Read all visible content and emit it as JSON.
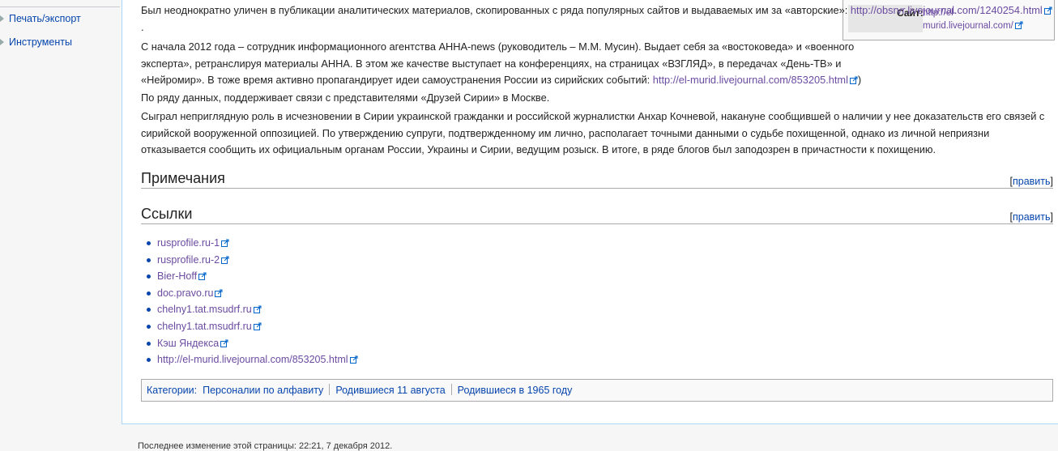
{
  "sidebar": {
    "items": [
      {
        "label": "Печать/экспорт"
      },
      {
        "label": "Инструменты"
      }
    ]
  },
  "infobox": {
    "site_label": "Сайт:",
    "site_url": "http://el-murid.livejournal.com/"
  },
  "article": {
    "p1_text": "Был неоднократно уличен в публикации аналитических материалов, скопированных с ряда популярных сайтов и выдаваемых им за «авторские»: ",
    "p1_link": "http://obsrvr.livejournal.com/1240254.html",
    "p1_tail": ".",
    "p2_text": "С начала 2012 года – сотрудник информационного агентства АННА-news (руководитель – М.М. Мусин). Выдает себя за «востоковеда» и «военного эксперта», ретранслируя материалы АННА.  В этом же качестве выступает на конференциях, на страницах «ВЗГЛЯД», в передачах «День-ТВ» и «Нейромир». В тоже время активно пропагандирует  идеи самоустранения России из сирийских событий: ",
    "p2_link": "http://el-murid.livejournal.com/853205.html",
    "p2_tail": ")",
    "p3_text": "По ряду данных, поддерживает связи с представителями «Друзей Сирии» в Москве.",
    "p4_text": "Сыграл неприглядную роль в исчезновении в Сирии украинской гражданки и российской журналистки Анхар Кочневой, накануне сообщившей о наличии у нее доказательств его связей с сирийской вооруженной оппозицией. По утверждению супруги, подтвержденному им лично, располагает точными данными о судьбе похищенной, однако из личной неприязни отказывается сообщить их официальным органам России, Украины и Сирии, ведущим розыск. В итоге, в ряде блогов был заподозрен в причастности к похищению."
  },
  "sections": {
    "notes_title": "Примечания",
    "links_title": "Ссылки",
    "edit_open": "[",
    "edit_label": "править",
    "edit_close": "]"
  },
  "links": [
    {
      "label": "rusprofile.ru-1"
    },
    {
      "label": "rusprofile.ru-2"
    },
    {
      "label": "Bier-Hoff"
    },
    {
      "label": "doc.pravo.ru"
    },
    {
      "label": "chelny1.tat.msudrf.ru"
    },
    {
      "label": "chelny1.tat.msudrf.ru"
    },
    {
      "label": "Кэш Яндекса"
    },
    {
      "label": "http://el-murid.livejournal.com/853205.html"
    }
  ],
  "categories": {
    "label": "Категории:",
    "items": [
      "Персоналии по алфавиту",
      "Родившиеся 11 августа",
      "Родившиеся в 1965 году"
    ]
  },
  "footer": {
    "text": "Последнее изменение этой страницы: 22:21, 7 декабря 2012."
  },
  "colors": {
    "link": "#0645ad",
    "visited": "#6b4ba1",
    "panel_border": "#a7d7f9"
  }
}
